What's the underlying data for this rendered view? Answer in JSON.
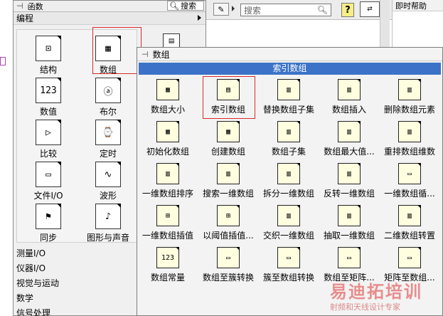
{
  "functions_palette": {
    "title": "函数",
    "search_label": "搜索",
    "section": "编程",
    "grid": [
      {
        "label": "结构",
        "icon_text": "⊡"
      },
      {
        "label": "数组",
        "icon_text": "▦"
      },
      {
        "label": "数值",
        "icon_text": "123"
      },
      {
        "label": "布尔",
        "icon_text": "ⓐ"
      },
      {
        "label": "比较",
        "icon_text": "▷"
      },
      {
        "label": "定时",
        "icon_text": "⌚"
      },
      {
        "label": "文件I/O",
        "icon_text": "▭"
      },
      {
        "label": "波形",
        "icon_text": "∿"
      },
      {
        "label": "同步",
        "icon_text": "⚑"
      },
      {
        "label": "图形与声音",
        "icon_text": "♪"
      }
    ],
    "list": [
      "测量I/O",
      "仪器I/O",
      "视觉与运动",
      "数学",
      "信号处理"
    ]
  },
  "toolbar": {
    "search_placeholder": "搜索",
    "help_label": "?"
  },
  "help_panel": {
    "title": "即时帮助"
  },
  "array_palette": {
    "title": "数组",
    "highlighted": "索引数组",
    "items": [
      {
        "label": "数组大小",
        "icon_text": "▦"
      },
      {
        "label": "索引数组",
        "icon_text": "▤"
      },
      {
        "label": "替换数组子集",
        "icon_text": "▥"
      },
      {
        "label": "数组插入",
        "icon_text": "▥"
      },
      {
        "label": "删除数组元素",
        "icon_text": "▥"
      },
      {
        "label": "初始化数组",
        "icon_text": "▦"
      },
      {
        "label": "创建数组",
        "icon_text": "▦"
      },
      {
        "label": "数组子集",
        "icon_text": "▥"
      },
      {
        "label": "数组最大值...",
        "icon_text": "▥"
      },
      {
        "label": "重排数组维数",
        "icon_text": "▥"
      },
      {
        "label": "一维数组排序",
        "icon_text": "▥"
      },
      {
        "label": "搜索一维数组",
        "icon_text": "▥"
      },
      {
        "label": "拆分一维数组",
        "icon_text": "▥"
      },
      {
        "label": "反转一维数组",
        "icon_text": "▥"
      },
      {
        "label": "一维数组循...",
        "icon_text": "▭"
      },
      {
        "label": "一维数组插值",
        "icon_text": "⊞"
      },
      {
        "label": "以阈值插值...",
        "icon_text": "⊞"
      },
      {
        "label": "交织一维数组",
        "icon_text": "▥"
      },
      {
        "label": "抽取一维数组",
        "icon_text": "▥"
      },
      {
        "label": "二维数组转置",
        "icon_text": "▥"
      },
      {
        "label": "数组常量",
        "icon_text": "123"
      },
      {
        "label": "数组至簇转换",
        "icon_text": "▭"
      },
      {
        "label": "簇至数组转换",
        "icon_text": "▭"
      },
      {
        "label": "数组至矩阵...",
        "icon_text": "▭"
      },
      {
        "label": "矩阵至数组...",
        "icon_text": "▭"
      }
    ]
  },
  "watermark": {
    "brand": "易迪拓培训",
    "sub": "射频和天线设计专家"
  }
}
